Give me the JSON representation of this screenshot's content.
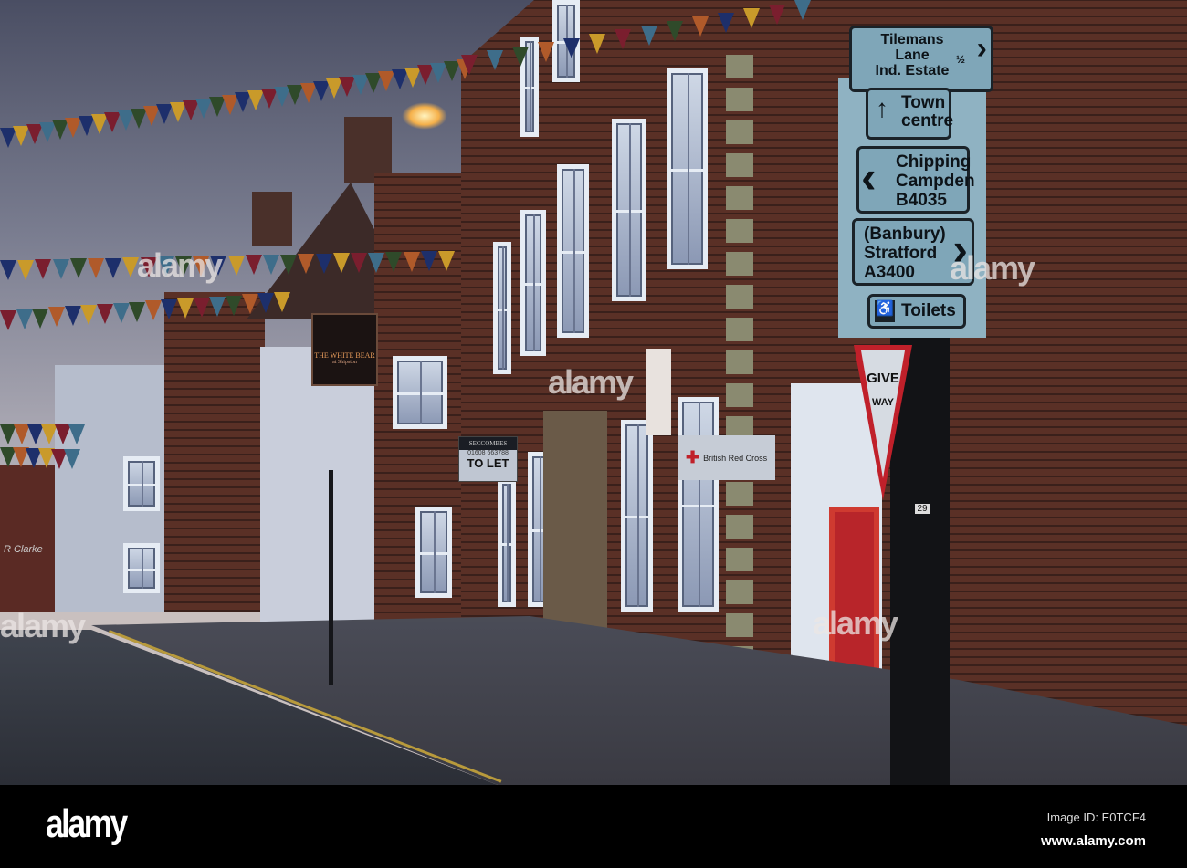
{
  "signs": {
    "direction": [
      {
        "lines": [
          "Tilemans",
          "Lane",
          "Ind. Estate"
        ],
        "distance": "½"
      },
      {
        "lines": [
          "Town",
          "centre"
        ]
      },
      {
        "lines": [
          "Chipping",
          "Campden",
          "B4035"
        ]
      },
      {
        "lines": [
          "(Banbury)",
          "Stratford",
          "A3400"
        ]
      },
      {
        "lines": [
          "Toilets"
        ]
      }
    ],
    "give_way": [
      "GIVE",
      "WAY"
    ],
    "pub_name": "THE WHITE BEAR",
    "pub_sub": "at Shipston",
    "agent_name": "SECCOMBES",
    "agent_phone": "01608 663788",
    "to_let": "TO LET",
    "charity": "British Red Cross",
    "shop_name": "R Clarke",
    "post_number": "29"
  },
  "watermark": {
    "logo": "alamy",
    "image_id": "Image ID: E0TCF4",
    "url": "www.alamy.com"
  },
  "bunting_colors": [
    "#1d2f6b",
    "#c99a2a",
    "#7a1e2e",
    "#3e6d8a",
    "#2f4a2a",
    "#b05a2a"
  ]
}
